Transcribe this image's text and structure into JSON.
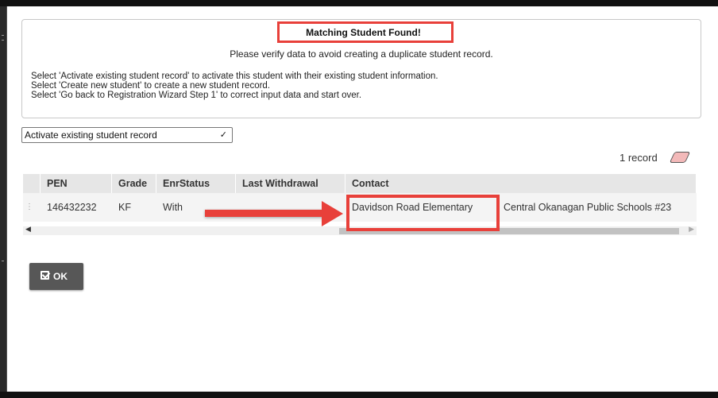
{
  "notice": {
    "title": "Matching Student Found!",
    "subtitle": "Please verify data to avoid creating a duplicate student record.",
    "lines": [
      "Select 'Activate existing student record' to activate this student with their existing student information.",
      "Select 'Create new student' to create a new student record.",
      "Select 'Go back to Registration Wizard Step 1' to correct input data and start over."
    ]
  },
  "action_select": {
    "value": "Activate existing student record",
    "chevron_icon": "chevron-down-icon"
  },
  "records": {
    "count_label": "1 record",
    "clear_icon": "eraser-icon"
  },
  "grid": {
    "columns": [
      "PEN",
      "Grade",
      "EnrStatus",
      "Last Withdrawal",
      "Contact"
    ],
    "row": {
      "pen": "146432232",
      "grade": "KF",
      "enr_status": "With",
      "last_withdrawal": "",
      "school": "Davidson Road Elementary",
      "district": "Central Okanagan Public Schools #23"
    }
  },
  "ok_button": {
    "label": "OK",
    "icon": "check-square-icon"
  },
  "annotation_color": "#e8403a"
}
